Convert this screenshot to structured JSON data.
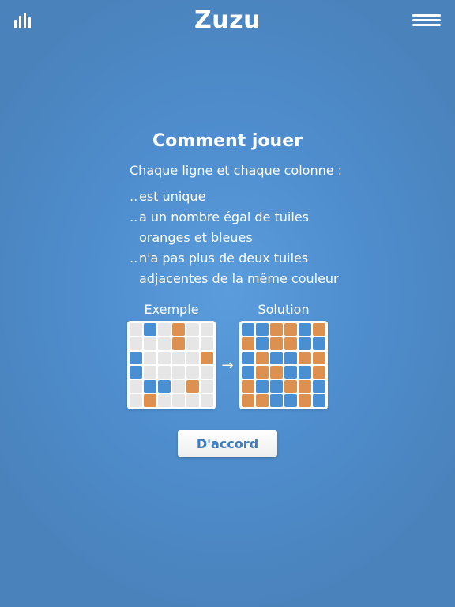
{
  "header": {
    "stats_icon": "bar-chart-icon",
    "title": "Zuzu",
    "menu_icon": "hamburger-menu-icon"
  },
  "dialog": {
    "title": "Comment jouer",
    "intro": "Chaque ligne et chaque colonne :",
    "rules": [
      {
        "prefix": "..",
        "text": "est unique"
      },
      {
        "prefix": "..",
        "text": "a un nombre égal de tuiles\noranges et bleues"
      },
      {
        "prefix": "..",
        "text": "n'a pas plus de deux tuiles\nadjacentes de la même couleur"
      }
    ],
    "example_label": "Exemple",
    "solution_label": "Solution",
    "arrow": "→",
    "ok_label": "D'accord",
    "example_grid": [
      [
        "e",
        "b",
        "e",
        "o",
        "e",
        "e"
      ],
      [
        "e",
        "e",
        "e",
        "o",
        "e",
        "e"
      ],
      [
        "b",
        "e",
        "e",
        "e",
        "e",
        "o"
      ],
      [
        "b",
        "e",
        "e",
        "e",
        "e",
        "e"
      ],
      [
        "e",
        "b",
        "b",
        "e",
        "o",
        "e"
      ],
      [
        "e",
        "o",
        "e",
        "e",
        "e",
        "e"
      ]
    ],
    "solution_grid": [
      [
        "b",
        "b",
        "o",
        "o",
        "b",
        "o"
      ],
      [
        "o",
        "b",
        "o",
        "o",
        "b",
        "b"
      ],
      [
        "b",
        "o",
        "b",
        "b",
        "o",
        "o"
      ],
      [
        "b",
        "o",
        "o",
        "b",
        "b",
        "o"
      ],
      [
        "o",
        "b",
        "b",
        "o",
        "o",
        "b"
      ],
      [
        "o",
        "o",
        "b",
        "b",
        "o",
        "b"
      ]
    ]
  },
  "colors": {
    "background": "#4f8ecf",
    "tile_blue": "#4a8fd2",
    "tile_orange": "#dc9150",
    "tile_empty": "#e6e6e6",
    "button_text": "#3d7cc0"
  }
}
